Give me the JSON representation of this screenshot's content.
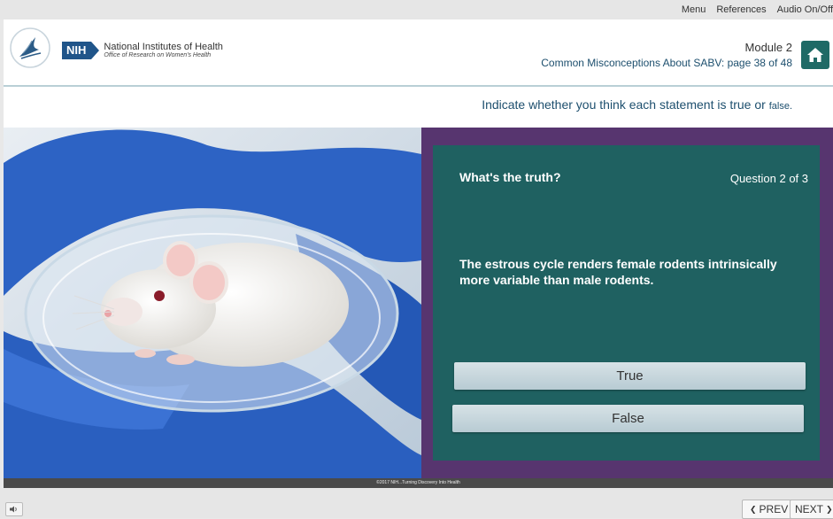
{
  "topnav": {
    "menu": "Menu",
    "references": "References",
    "audio": "Audio On/Off"
  },
  "header": {
    "org_badge": "NIH",
    "org_name": "National Institutes of Health",
    "org_office": "Office of Research on Women's Health",
    "module_title": "Module 2",
    "module_subtitle": "Common Misconceptions About SABV: page 38 of 48"
  },
  "instruction": {
    "main": "Indicate whether you think each statement is true or ",
    "small": "false."
  },
  "photo": {
    "credit": "©2017 NIH...Turning Discovery Into Health"
  },
  "quiz": {
    "heading": "What's the truth?",
    "question_count": "Question 2  of 3",
    "statement": "The estrous cycle renders female rodents intrinsically more variable than male rodents.",
    "answers": {
      "true": "True",
      "false": "False"
    }
  },
  "footer": {
    "audio_icon": "speaker-icon",
    "prev": "PREV",
    "next": "NEXT"
  },
  "colors": {
    "quiz_frame": "#57356f",
    "quiz_panel": "#1f6161",
    "accent_text": "#1d4f6e",
    "nih_blue": "#20558a"
  }
}
